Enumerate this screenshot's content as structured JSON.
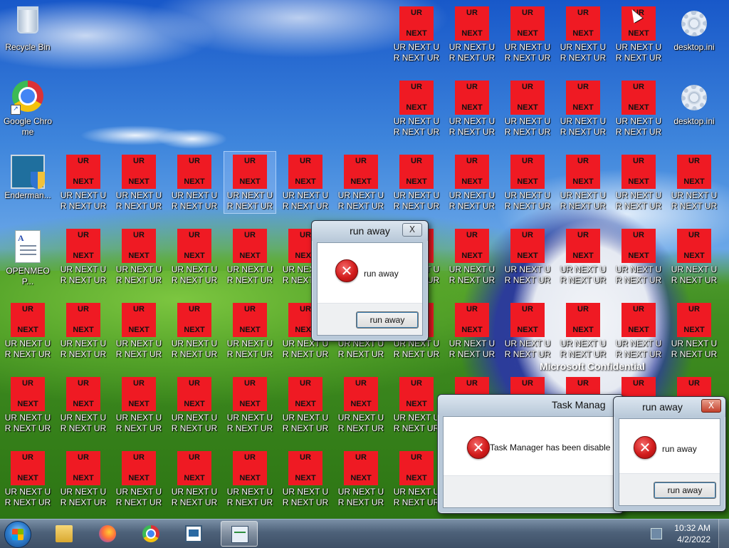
{
  "desktop": {
    "icons_system": [
      {
        "name": "recycle-bin",
        "label": "Recycle Bin"
      },
      {
        "name": "google-chrome",
        "label": "Google Chrome"
      },
      {
        "name": "enderman-app",
        "label": "Enderman..."
      },
      {
        "name": "openmeop-doc",
        "label": "OPENMEOP..."
      },
      {
        "name": "desktop-ini-1",
        "label": "desktop.ini"
      },
      {
        "name": "desktop-ini-2",
        "label": "desktop.ini"
      }
    ],
    "ur_icon": {
      "top_text": "UR",
      "bottom_text": "NEXT",
      "label": "UR NEXT UR NEXT UR ..."
    },
    "watermark": {
      "line1": "Microsoft Confidential"
    }
  },
  "dialog_run_away_1": {
    "title": "run away",
    "message": "run away",
    "button": "run away",
    "close_label": "X"
  },
  "dialog_task_manager": {
    "title": "Task Manag",
    "message": "Task Manager has been disable"
  },
  "dialog_run_away_2": {
    "title": "run away",
    "message": "run away",
    "button": "run away",
    "close_label": "X"
  },
  "taskbar": {
    "items": [
      "start-button",
      "explorer",
      "firefox",
      "chrome",
      "app-window",
      "task-manager"
    ],
    "clock_time": "10:32 AM",
    "clock_date": "4/2/2022"
  },
  "colors": {
    "ur_red": "#ef1a23",
    "taskbar": "#4d6179"
  }
}
